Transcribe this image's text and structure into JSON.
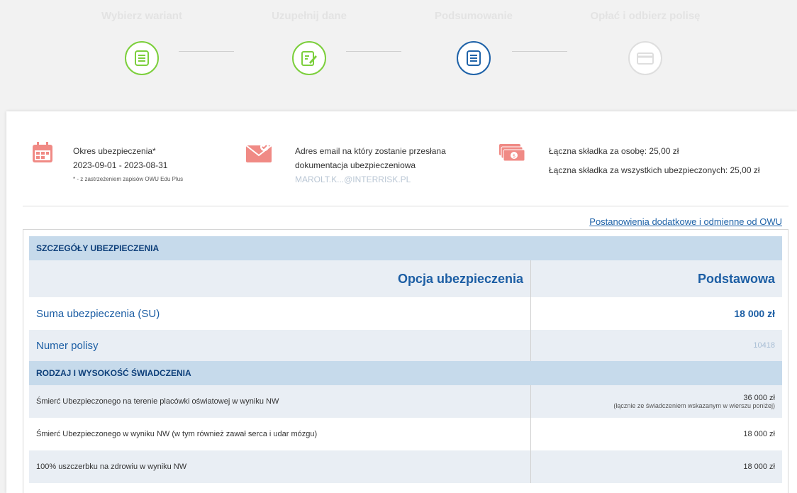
{
  "steps": [
    {
      "label": "Wybierz wariant",
      "state": "done",
      "icon": "checklist-icon"
    },
    {
      "label": "Uzupełnij dane",
      "state": "done",
      "icon": "edit-form-icon"
    },
    {
      "label": "Podsumowanie",
      "state": "active",
      "icon": "summary-list-icon"
    },
    {
      "label": "Opłać i odbierz polisę",
      "state": "disabled",
      "icon": "payment-card-icon"
    }
  ],
  "info": {
    "period_label": "Okres ubezpieczenia*",
    "period_value": "2023-09-01 - 2023-08-31",
    "period_note": "* - z zastrzeżeniem zapisów OWU Edu Plus",
    "email_label_1": "Adres email na który zostanie przesłana",
    "email_label_2": "dokumentacja ubezpieczeniowa",
    "email_value": "MAROLT.K...@INTERRISK.PL",
    "premium_person": "Łączna składka za osobę: 25,00 zł",
    "premium_all": "Łączna składka za wszystkich ubezpieczonych: 25,00 zł"
  },
  "owu_link": "Postanowienia dodatkowe i odmienne od OWU",
  "table": {
    "section1": "SZCZEGÓŁY UBEZPIECZENIA",
    "option_label": "Opcja ubezpieczenia",
    "option_value": "Podstawowa",
    "su_label": "Suma ubezpieczenia (SU)",
    "su_value": "18 000 zł",
    "policy_label": "Numer polisy",
    "policy_value": "10418",
    "section2": "RODZAJ I WYSOKOŚĆ ŚWIADCZENIA",
    "benefits": [
      {
        "label": "Śmierć Ubezpieczonego na terenie placówki oświatowej w wyniku NW",
        "value": "36 000 zł",
        "note": "(łącznie ze świadczeniem wskazanym w wierszu poniżej)"
      },
      {
        "label": "Śmierć Ubezpieczonego w wyniku NW (w tym również zawał serca i udar mózgu)",
        "value": "18 000 zł",
        "note": ""
      },
      {
        "label": "100% uszczerbku na zdrowiu w wyniku NW",
        "value": "18 000 zł",
        "note": ""
      }
    ]
  },
  "colors": {
    "green": "#7ccf3c",
    "blue": "#1e62a8",
    "salmon": "#f08a85",
    "section_bg": "#c6daeb"
  }
}
